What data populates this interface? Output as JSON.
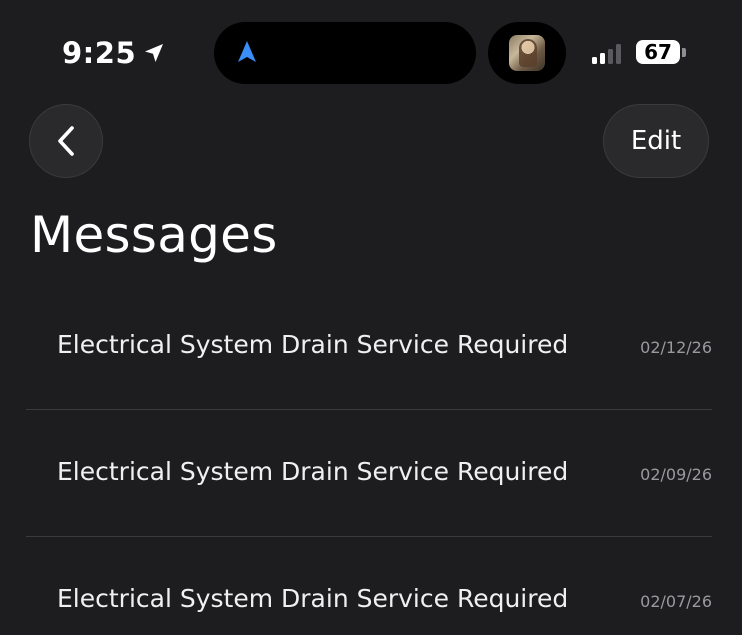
{
  "status_bar": {
    "time": "9:25",
    "battery": "67"
  },
  "nav": {
    "edit_label": "Edit"
  },
  "page": {
    "title": "Messages"
  },
  "messages": [
    {
      "title": "Electrical System Drain Service Required",
      "date": "02/12/26"
    },
    {
      "title": "Electrical System Drain Service Required",
      "date": "02/09/26"
    },
    {
      "title": "Electrical System Drain Service Required",
      "date": "02/07/26"
    }
  ],
  "colors": {
    "background": "#1d1d1f",
    "nav_arrow_accent": "#3a8ef6",
    "date_text": "#9a9a9e"
  },
  "icons": {
    "location": "location-arrow-icon",
    "navigation": "navigation-arrow-icon",
    "back": "chevron-left-icon"
  }
}
